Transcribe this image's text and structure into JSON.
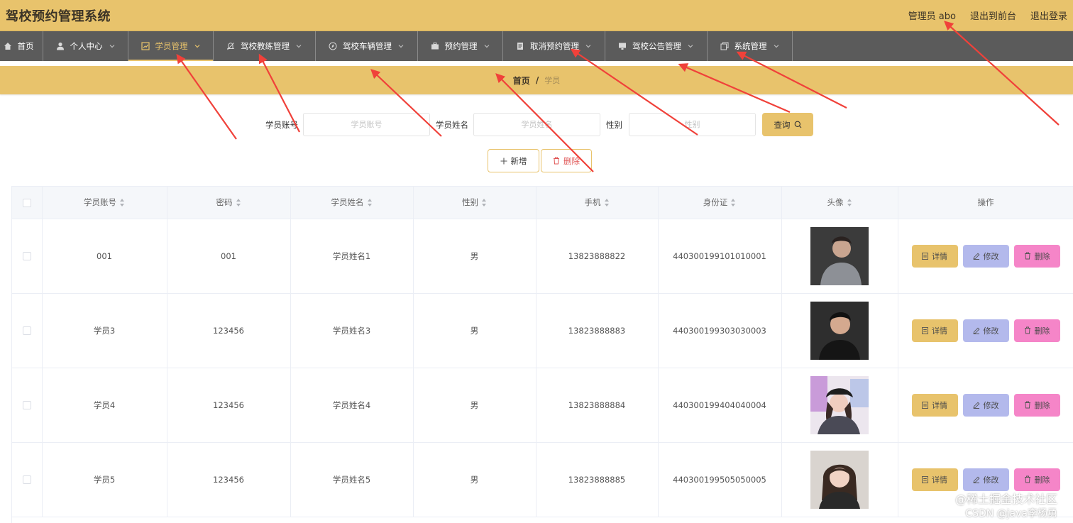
{
  "header": {
    "title": "驾校预约管理系统",
    "user_label": "管理员 abo",
    "front_label": "退出到前台",
    "logout_label": "退出登录"
  },
  "menu": {
    "items": [
      {
        "label": "首页",
        "icon": "home-icon"
      },
      {
        "label": "个人中心",
        "icon": "user-icon"
      },
      {
        "label": "学员管理",
        "icon": "chart-icon",
        "active": true
      },
      {
        "label": "驾校教练管理",
        "icon": "bell-icon"
      },
      {
        "label": "驾校车辆管理",
        "icon": "compass-icon"
      },
      {
        "label": "预约管理",
        "icon": "briefcase-icon"
      },
      {
        "label": "取消预约管理",
        "icon": "document-icon"
      },
      {
        "label": "驾校公告管理",
        "icon": "monitor-icon"
      },
      {
        "label": "系统管理",
        "icon": "copy-icon"
      }
    ]
  },
  "breadcrumb": {
    "home": "首页",
    "separator": "/",
    "current": "学员"
  },
  "search": {
    "account_label": "学员账号",
    "account_placeholder": "学员账号",
    "name_label": "学员姓名",
    "name_placeholder": "学员姓名",
    "gender_label": "性别",
    "gender_placeholder": "性别",
    "query_label": "查询"
  },
  "actions": {
    "add_label": "新增",
    "delete_label": "删除"
  },
  "table": {
    "headers": [
      "学员账号",
      "密码",
      "学员姓名",
      "性别",
      "手机",
      "身份证",
      "头像",
      "操作"
    ],
    "rows": [
      {
        "account": "001",
        "password": "001",
        "name": "学员姓名1",
        "gender": "男",
        "phone": "13823888822",
        "id_card": "440300199101010001"
      },
      {
        "account": "学员3",
        "password": "123456",
        "name": "学员姓名3",
        "gender": "男",
        "phone": "13823888883",
        "id_card": "440300199303030003"
      },
      {
        "account": "学员4",
        "password": "123456",
        "name": "学员姓名4",
        "gender": "男",
        "phone": "13823888884",
        "id_card": "440300199404040004"
      },
      {
        "account": "学员5",
        "password": "123456",
        "name": "学员姓名5",
        "gender": "男",
        "phone": "13823888885",
        "id_card": "440300199505050005"
      }
    ],
    "op_detail": "详情",
    "op_edit": "修改",
    "op_delete": "删除"
  },
  "watermark": {
    "line1": "@稀土掘金技术社区",
    "line2": "CSDN @java李杨勇"
  },
  "colors": {
    "accent": "#e8c36c",
    "menu_bg": "#5b5b5b",
    "edit": "#b3b9ec",
    "delete": "#f585c8",
    "annotation": "#f0413a"
  }
}
